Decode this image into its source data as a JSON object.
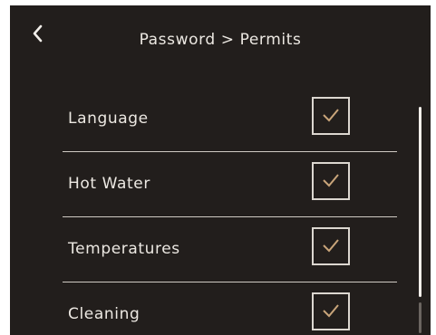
{
  "header": {
    "back_icon": "chevron-left-icon",
    "title": "Password > Permits"
  },
  "permits": [
    {
      "label": "Language",
      "checked": true
    },
    {
      "label": "Hot Water",
      "checked": true
    },
    {
      "label": "Temperatures",
      "checked": true
    },
    {
      "label": "Cleaning",
      "checked": true
    }
  ],
  "colors": {
    "background": "#221e1c",
    "text": "#ece8e2",
    "checkmark": "#c9a57a",
    "divider": "#cfcac3"
  }
}
